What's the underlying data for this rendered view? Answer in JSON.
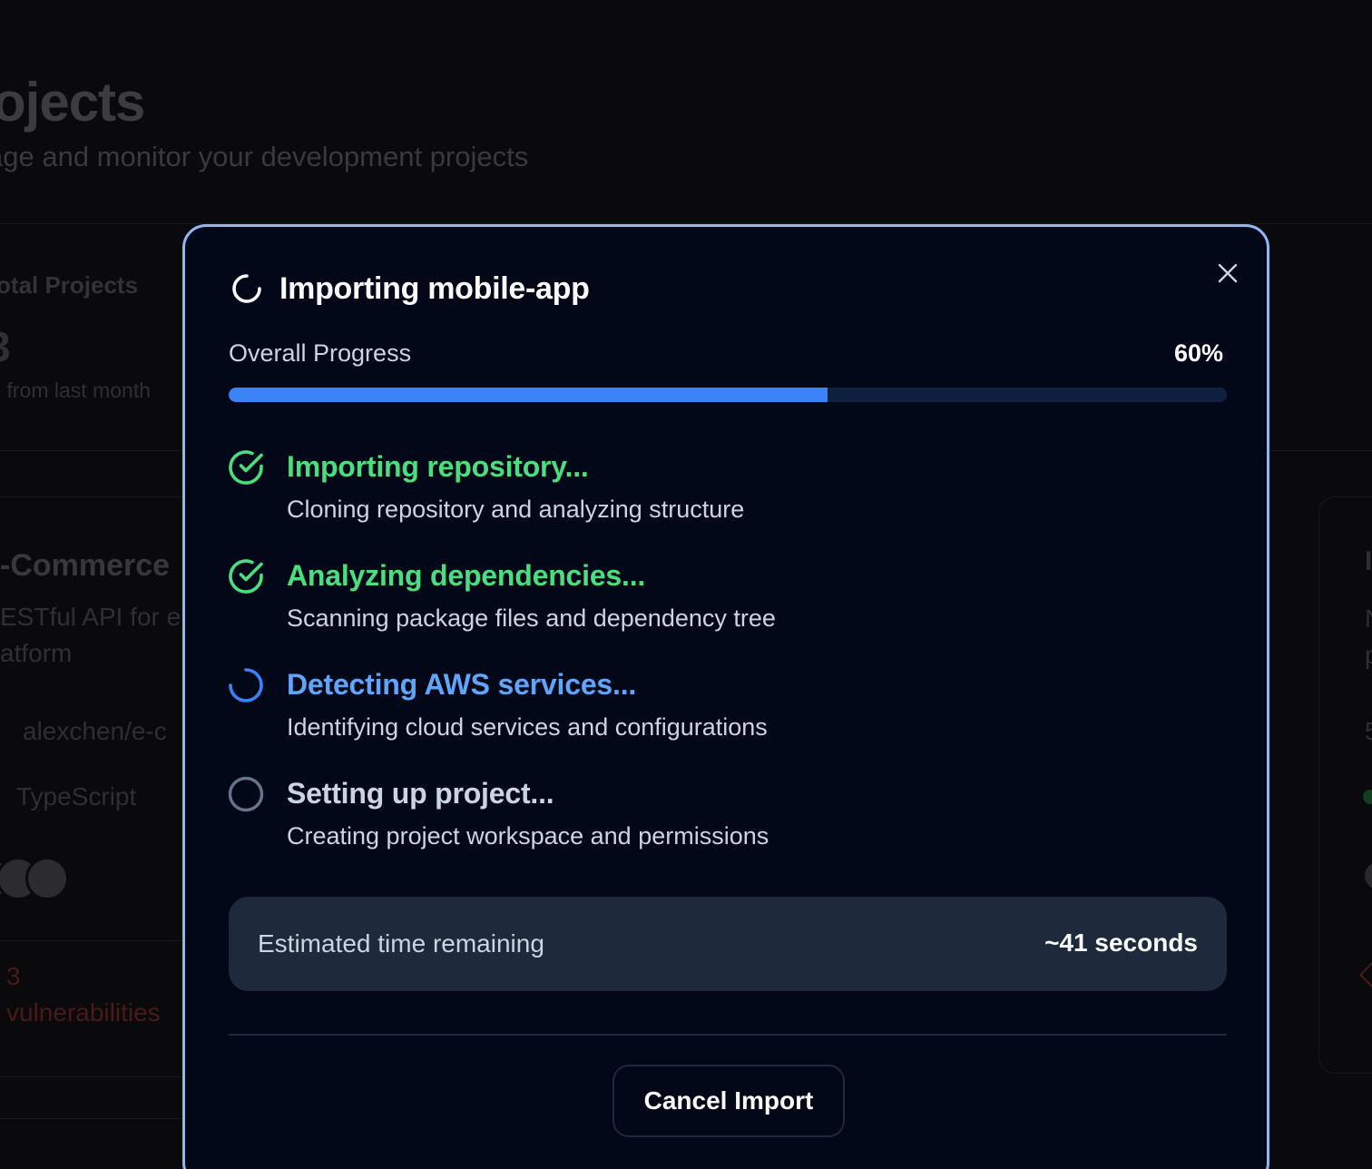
{
  "background": {
    "page_title": "ojects",
    "page_subtitle": "age and monitor your development projects",
    "stat": {
      "label": "otal Projects",
      "value": "3",
      "delta": "l from last month"
    },
    "card": {
      "title": "-Commerce",
      "description": "ESTful API for e\natform",
      "repo": "alexchen/e-c",
      "language": "TypeScript",
      "vuln_count": "3",
      "vuln_label": "vulnerabilities"
    },
    "right_card": {
      "frag_title": "I",
      "frag_desc1": "N",
      "frag_desc2": "p",
      "frag_num": "5"
    }
  },
  "modal": {
    "title": "Importing mobile-app",
    "close_icon": "close-icon",
    "progress": {
      "label": "Overall Progress",
      "percent_text": "60%",
      "value": 0.6
    },
    "steps": [
      {
        "status": "done",
        "title": "Importing repository...",
        "description": "Cloning repository and analyzing structure"
      },
      {
        "status": "done",
        "title": "Analyzing dependencies...",
        "description": "Scanning package files and dependency tree"
      },
      {
        "status": "active",
        "title": "Detecting AWS services...",
        "description": "Identifying cloud services and configurations"
      },
      {
        "status": "pending",
        "title": "Setting up project...",
        "description": "Creating project workspace and permissions"
      }
    ],
    "eta": {
      "label": "Estimated time remaining",
      "value": "~41 seconds"
    },
    "cancel_label": "Cancel Import"
  },
  "colors": {
    "accent": "#3b82f6",
    "success": "#4ade80",
    "active": "#60a5fa",
    "modal_border": "#8fb7f2",
    "modal_bg": "#020817"
  }
}
